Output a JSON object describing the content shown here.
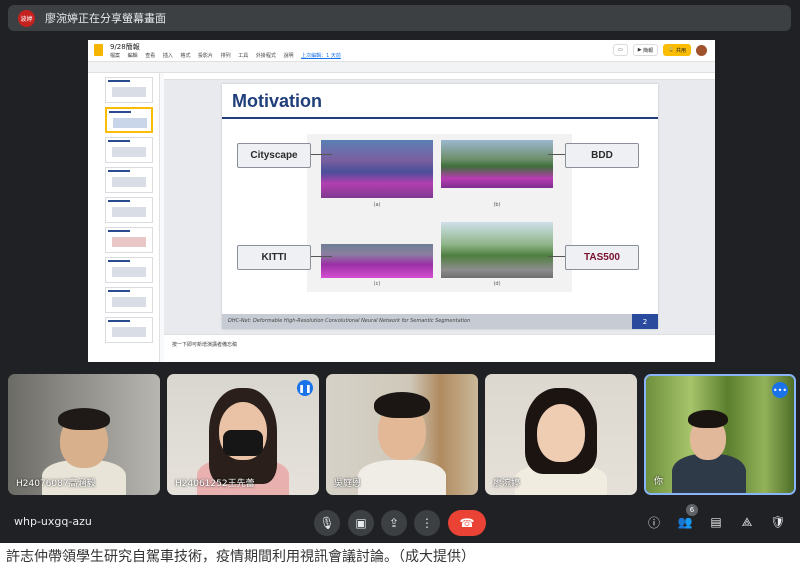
{
  "banner": {
    "avatar_text": "波婷",
    "text": "廖涴婷正在分享螢幕畫面"
  },
  "slides_app": {
    "doc_title": "9/28簡報",
    "menus": [
      "檔案",
      "編輯",
      "查看",
      "插入",
      "格式",
      "投影片",
      "排列",
      "工具",
      "外掛程式",
      "說明"
    ],
    "last_edit": "上次編輯：1 天前",
    "present_label": "簡報",
    "share_label": "共用",
    "notes_text": "按一下即可新增演講者備忘稿"
  },
  "slide": {
    "title": "Motivation",
    "labels": {
      "cityscape": "Cityscape",
      "bdd": "BDD",
      "kitti": "KITTI",
      "tas500": "TAS500"
    },
    "captions": [
      "(a)",
      "(b)",
      "(c)",
      "(d)"
    ],
    "footer": "DHC-Net: Deformable High-Resolution Convolutional Neural Network for Semantic Segmentation",
    "page_number": "2"
  },
  "participants": [
    {
      "name": "H24076087高涵毅"
    },
    {
      "name": "H24061252王先蕾"
    },
    {
      "name": "吳庭恩"
    },
    {
      "name": "廖涴婷"
    },
    {
      "name": "你"
    }
  ],
  "meeting": {
    "code": "whp-uxgq-azu",
    "people_count": "6"
  },
  "caption": "許志仲帶領學生研究自駕車技術，疫情期間利用視訊會議討論。（成大提供）",
  "colors": {
    "accent_blue": "#1f3e7a",
    "end_call": "#ea4335",
    "share_button": "#fbbc04"
  }
}
